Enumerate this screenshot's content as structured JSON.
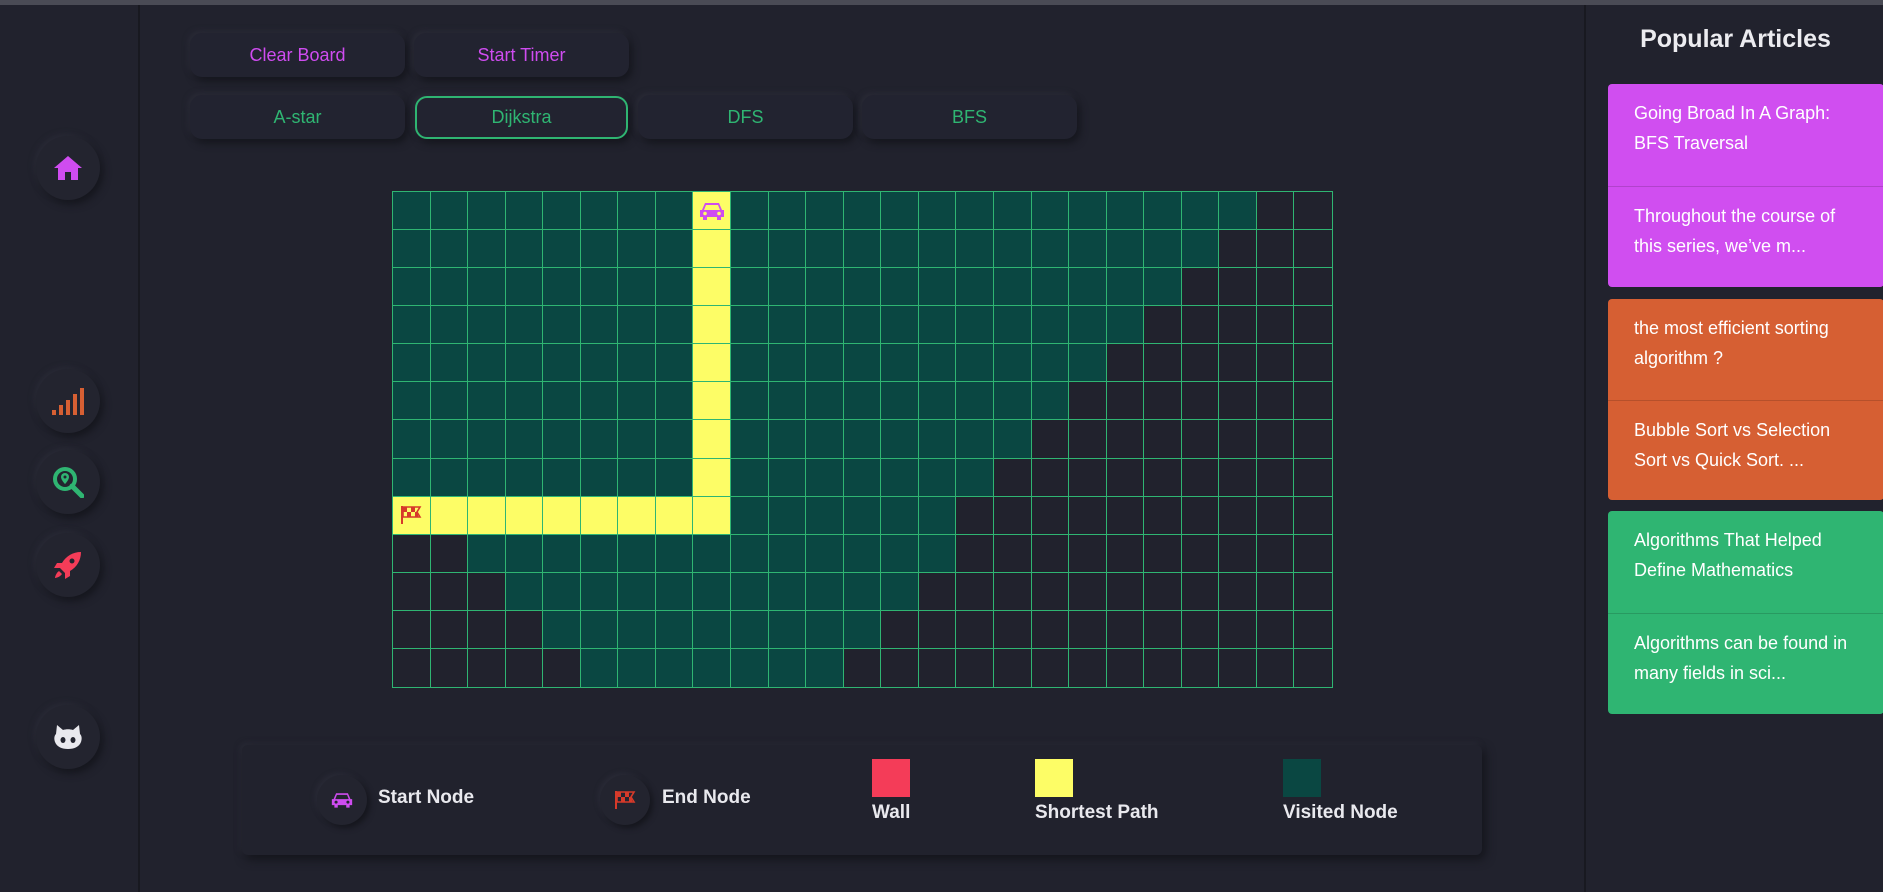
{
  "sidebar": {
    "icons": [
      "home-icon",
      "signal-bars-icon",
      "search-location-icon",
      "rocket-icon",
      "github-icon"
    ],
    "colors": {
      "home": "#cf4cf0",
      "signal": "#d65f33",
      "search": "#2fb572",
      "rocket": "#f43c58",
      "github": "#e9e9ee"
    }
  },
  "controls": {
    "clear_board": "Clear Board",
    "start_timer": "Start Timer",
    "algorithms": [
      "A-star",
      "Dijkstra",
      "DFS",
      "BFS"
    ],
    "active_algorithm": "Dijkstra"
  },
  "grid": {
    "rows": 13,
    "cols": 25,
    "start_node": {
      "row": 0,
      "col": 8
    },
    "end_node": {
      "row": 8,
      "col": 0
    },
    "visited_extent_by_row": [
      23,
      22,
      21,
      20,
      19,
      18,
      17,
      16,
      15,
      15,
      14,
      13,
      12
    ],
    "unvisited_head_by_row": [
      0,
      0,
      0,
      0,
      0,
      0,
      0,
      0,
      0,
      2,
      3,
      4,
      5
    ],
    "shortest_path": [
      [
        0,
        8
      ],
      [
        1,
        8
      ],
      [
        2,
        8
      ],
      [
        3,
        8
      ],
      [
        4,
        8
      ],
      [
        5,
        8
      ],
      [
        6,
        8
      ],
      [
        7,
        8
      ],
      [
        8,
        8
      ],
      [
        8,
        7
      ],
      [
        8,
        6
      ],
      [
        8,
        5
      ],
      [
        8,
        4
      ],
      [
        8,
        3
      ],
      [
        8,
        2
      ],
      [
        8,
        1
      ],
      [
        8,
        0
      ]
    ]
  },
  "legend": {
    "start": "Start Node",
    "end": "End Node",
    "wall": "Wall",
    "shortest": "Shortest Path",
    "visited": "Visited Node",
    "colors": {
      "wall": "#f43c58",
      "shortest": "#fdfd66",
      "visited": "#0a4742",
      "start_icon": "#cf4cf0",
      "end_icon": "#d63a2a"
    }
  },
  "articles": {
    "heading": "Popular Articles",
    "items": [
      {
        "title": "Going Broad In A Graph: BFS Traversal",
        "excerpt": "Throughout the course of this series, we’ve m...",
        "color": "#d04ef0"
      },
      {
        "title": "the most efficient sorting algorithm ?",
        "excerpt": "Bubble Sort vs Selection Sort vs Quick Sort. ...",
        "color": "#d65f33"
      },
      {
        "title": "Algorithms That Helped Define Mathematics",
        "excerpt": "Algorithms can be found in many fields in sci...",
        "color": "#2fb572"
      }
    ]
  }
}
